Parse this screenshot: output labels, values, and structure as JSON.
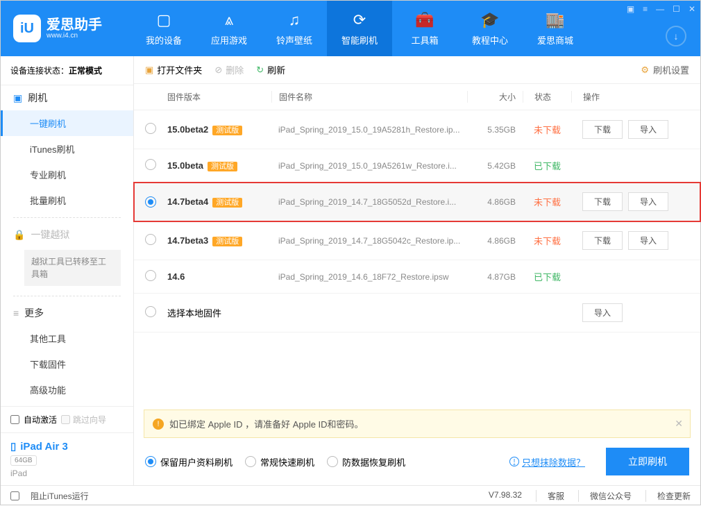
{
  "brand": {
    "name": "爱思助手",
    "url": "www.i4.cn"
  },
  "nav": {
    "items": [
      {
        "label": "我的设备",
        "icon": "▢"
      },
      {
        "label": "应用游戏",
        "icon": "⩓"
      },
      {
        "label": "铃声壁纸",
        "icon": "♫"
      },
      {
        "label": "智能刷机",
        "icon": "⟳"
      },
      {
        "label": "工具箱",
        "icon": "🧰"
      },
      {
        "label": "教程中心",
        "icon": "🎓"
      },
      {
        "label": "爱思商城",
        "icon": "🏬"
      }
    ],
    "active_index": 3
  },
  "sidebar": {
    "conn_label": "设备连接状态：",
    "conn_value": "正常模式",
    "flash_head": "刷机",
    "items": [
      "一键刷机",
      "iTunes刷机",
      "专业刷机",
      "批量刷机"
    ],
    "active_item_index": 0,
    "jailbreak_head": "一键越狱",
    "jailbreak_note": "越狱工具已转移至工具箱",
    "more_head": "更多",
    "more_items": [
      "其他工具",
      "下载固件",
      "高级功能"
    ],
    "auto_activate": "自动激活",
    "skip_guide": "跳过向导",
    "device_name": "iPad Air 3",
    "device_capacity": "64GB",
    "device_type": "iPad"
  },
  "toolbar": {
    "open": "打开文件夹",
    "delete": "删除",
    "refresh": "刷新",
    "settings": "刷机设置"
  },
  "columns": {
    "version": "固件版本",
    "name": "固件名称",
    "size": "大小",
    "status": "状态",
    "ops": "操作"
  },
  "rows": [
    {
      "version": "15.0beta2",
      "beta": "测试版",
      "name": "iPad_Spring_2019_15.0_19A5281h_Restore.ip...",
      "size": "5.35GB",
      "status": "未下载",
      "status_class": "st-not",
      "ops": [
        "下载",
        "导入"
      ],
      "selected": false
    },
    {
      "version": "15.0beta",
      "beta": "测试版",
      "name": "iPad_Spring_2019_15.0_19A5261w_Restore.i...",
      "size": "5.42GB",
      "status": "已下载",
      "status_class": "st-done",
      "ops": [],
      "selected": false
    },
    {
      "version": "14.7beta4",
      "beta": "测试版",
      "name": "iPad_Spring_2019_14.7_18G5052d_Restore.i...",
      "size": "4.86GB",
      "status": "未下载",
      "status_class": "st-not",
      "ops": [
        "下载",
        "导入"
      ],
      "selected": true,
      "highlighted": true
    },
    {
      "version": "14.7beta3",
      "beta": "测试版",
      "name": "iPad_Spring_2019_14.7_18G5042c_Restore.ip...",
      "size": "4.86GB",
      "status": "未下载",
      "status_class": "st-not",
      "ops": [
        "下载",
        "导入"
      ],
      "selected": false
    },
    {
      "version": "14.6",
      "beta": "",
      "name": "iPad_Spring_2019_14.6_18F72_Restore.ipsw",
      "size": "4.87GB",
      "status": "已下载",
      "status_class": "st-done",
      "ops": [],
      "selected": false
    },
    {
      "version": "选择本地固件",
      "beta": "",
      "name": "",
      "size": "",
      "status": "",
      "status_class": "",
      "ops": [
        "导入"
      ],
      "selected": false,
      "local": true
    }
  ],
  "notice": "如已绑定 Apple ID ，请准备好 Apple ID和密码。",
  "flash_options": {
    "opts": [
      "保留用户资料刷机",
      "常规快速刷机",
      "防数据恢复刷机"
    ],
    "selected": 0,
    "erase_link": "只想抹除数据？",
    "flash_now": "立即刷机"
  },
  "footer": {
    "block_itunes": "阻止iTunes运行",
    "version": "V7.98.32",
    "service": "客服",
    "wechat": "微信公众号",
    "update": "检查更新"
  }
}
